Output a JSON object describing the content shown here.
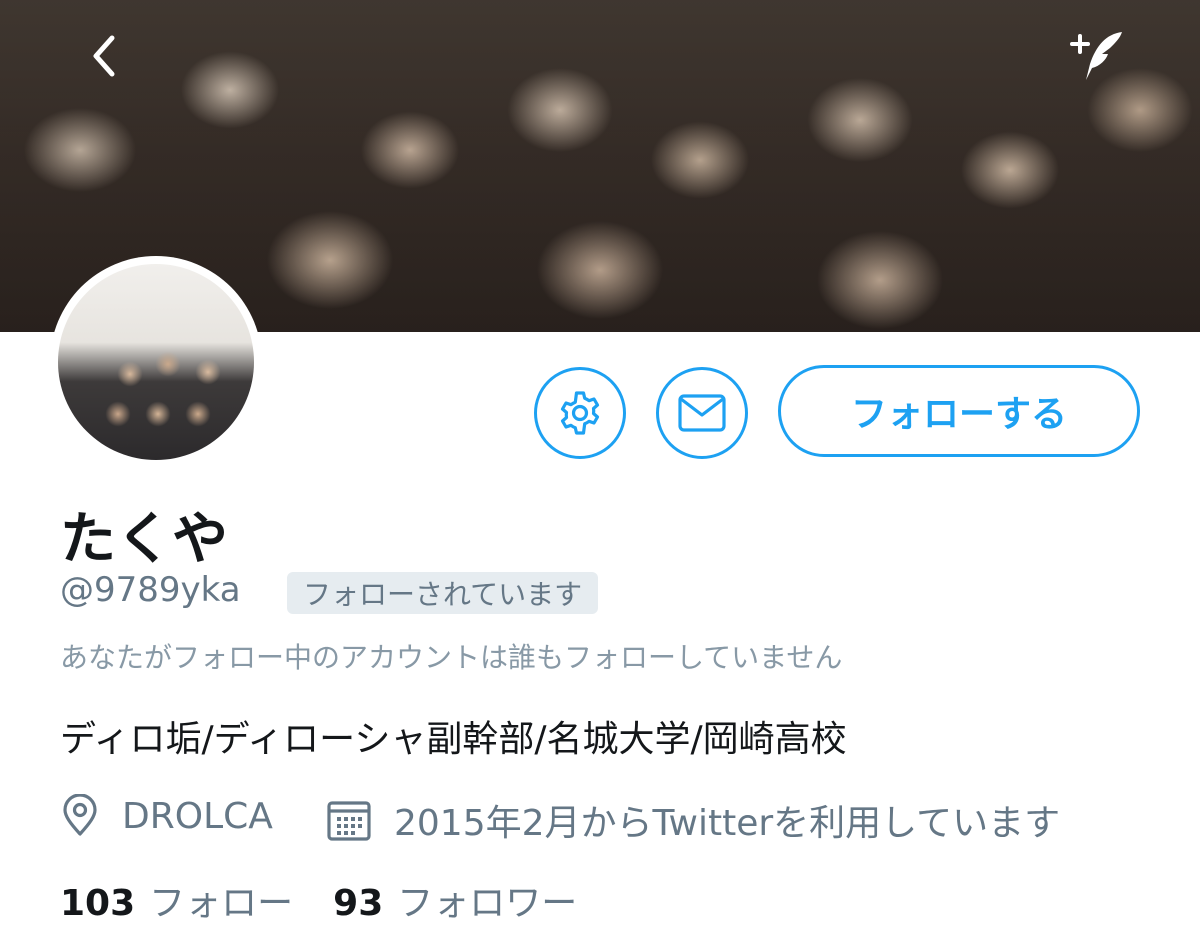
{
  "colors": {
    "accent": "#1da1f2",
    "secondary_text": "#657786",
    "badge_bg": "#e6ecf0"
  },
  "header": {
    "back_icon": "chevron-left-icon",
    "compose_icon": "compose-tweet-icon"
  },
  "actions": {
    "settings_icon": "gear-icon",
    "dm_icon": "envelope-icon",
    "follow_label": "フォローする"
  },
  "profile": {
    "display_name": "たくや",
    "handle": "@9789yka",
    "follows_you_badge": "フォローされています",
    "mutual_note": "あなたがフォロー中のアカウントは誰もフォローしていません",
    "bio": "ディロ垢/ディローシャ副幹部/名城大学/岡崎高校",
    "location": "DROLCA",
    "joined": "2015年2月からTwitterを利用しています"
  },
  "stats": {
    "following_count": "103",
    "following_label": "フォロー",
    "followers_count": "93",
    "followers_label": "フォロワー"
  }
}
